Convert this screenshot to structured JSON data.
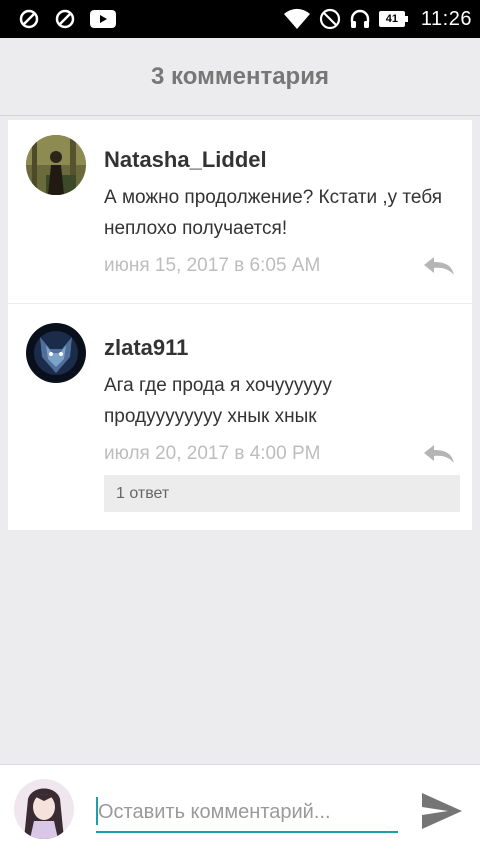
{
  "status_bar": {
    "time": "11:26",
    "battery_level": "41",
    "icons_left": [
      "block-icon",
      "block-icon",
      "youtube-icon"
    ],
    "icons_right": [
      "wifi-icon",
      "do-not-disturb-icon",
      "headset-icon",
      "battery-icon"
    ]
  },
  "header": {
    "title": "3 комментария"
  },
  "comments": [
    {
      "author": "Natasha_Liddel",
      "text": "А можно продолжение? Кстати ,у тебя неплохо получается!",
      "date": "июня 15, 2017 в 6:05 AM",
      "avatar": "forest-figure-avatar",
      "reply_icon": "reply-icon"
    },
    {
      "author": "zlata911",
      "text": "Ага где прода я хочуууууу продуууууууу хнык хнык",
      "date": "июля 20, 2017 в 4:00 PM",
      "avatar": "wolf-avatar",
      "reply_icon": "reply-icon",
      "replies_label": "1 ответ"
    }
  ],
  "composer": {
    "placeholder": "Оставить комментарий...",
    "value": "",
    "send_icon": "send-icon",
    "accent_color": "#1aa0a6"
  }
}
